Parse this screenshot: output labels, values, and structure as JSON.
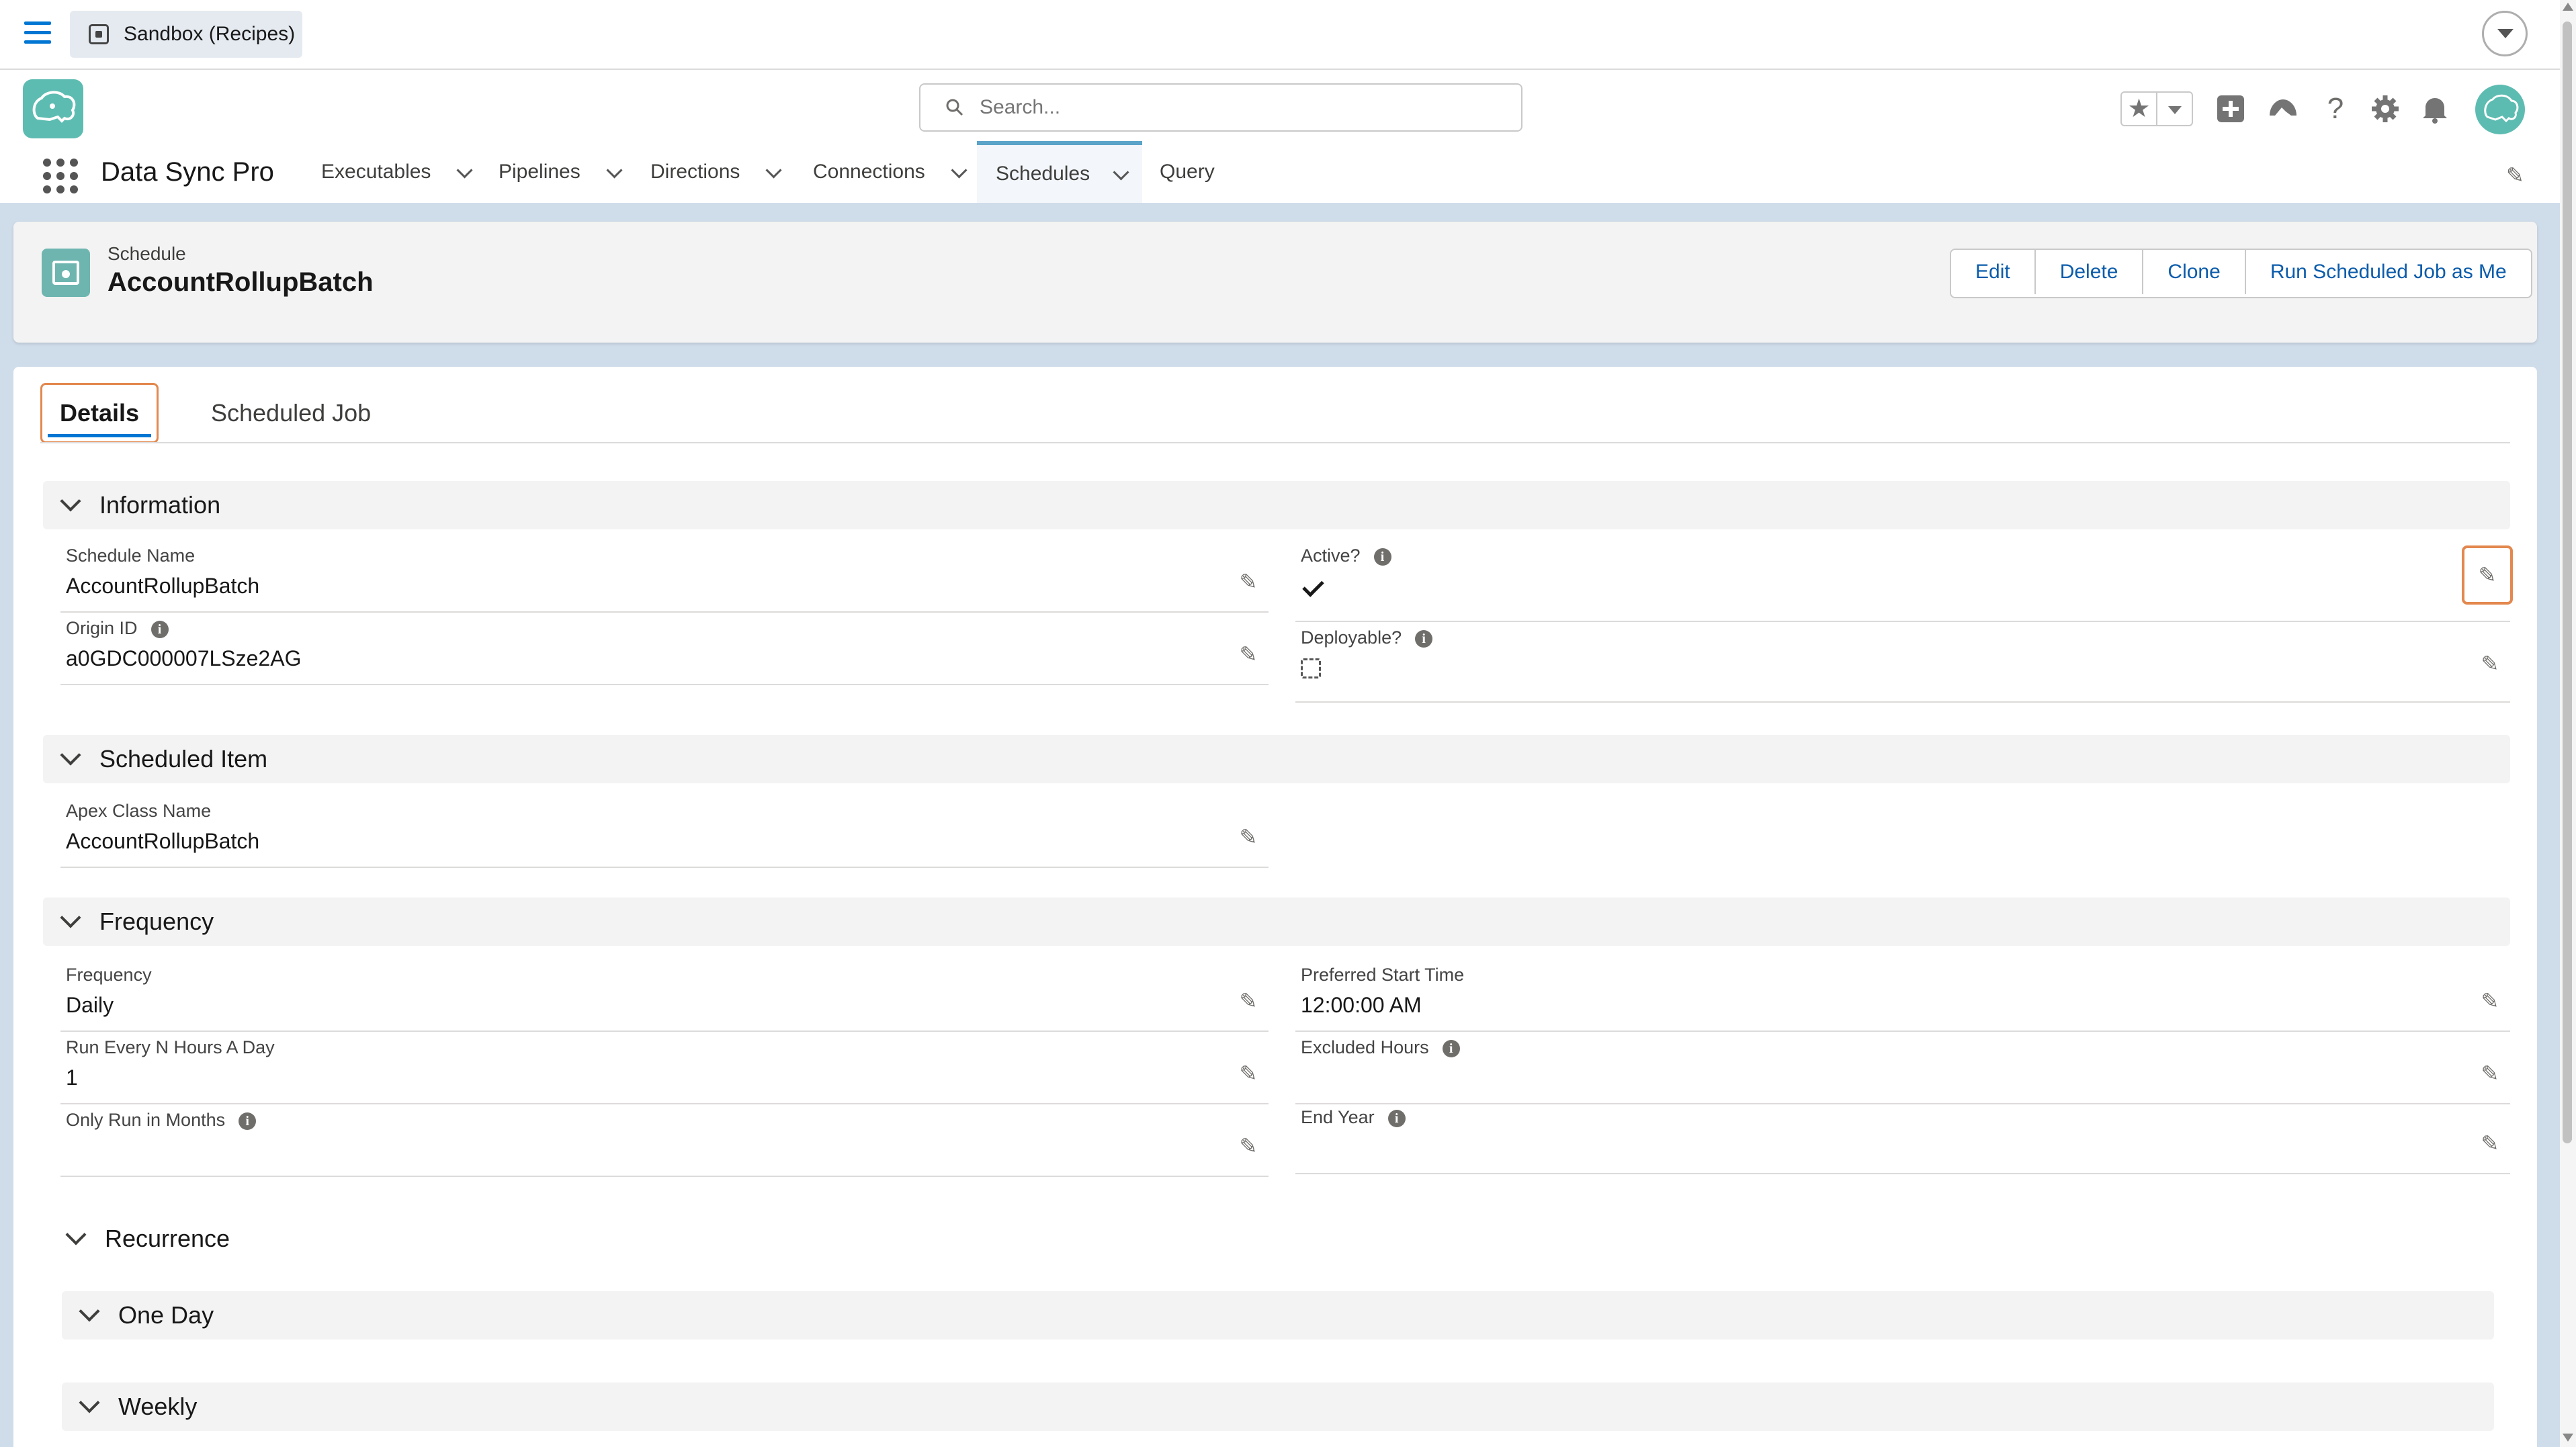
{
  "topbar": {
    "org_label": "Sandbox (Recipes)"
  },
  "search": {
    "placeholder": "Search..."
  },
  "nav": {
    "app_name": "Data Sync Pro",
    "items": [
      {
        "label": "Executables",
        "has_menu": true
      },
      {
        "label": "Pipelines",
        "has_menu": true
      },
      {
        "label": "Directions",
        "has_menu": true
      },
      {
        "label": "Connections",
        "has_menu": true
      },
      {
        "label": "Schedules",
        "has_menu": true,
        "active": true
      },
      {
        "label": "Query",
        "has_menu": false
      }
    ]
  },
  "record": {
    "type": "Schedule",
    "name": "AccountRollupBatch",
    "actions": [
      "Edit",
      "Delete",
      "Clone",
      "Run Scheduled Job as Me"
    ]
  },
  "tabs": {
    "active": "Details",
    "other": "Scheduled Job"
  },
  "sections": {
    "information": {
      "title": "Information",
      "schedule_name": {
        "label": "Schedule Name",
        "value": "AccountRollupBatch"
      },
      "origin_id": {
        "label": "Origin ID",
        "value": "a0GDC000007LSze2AG"
      },
      "active": {
        "label": "Active?",
        "checked": true
      },
      "deployable": {
        "label": "Deployable?",
        "checked": false
      }
    },
    "scheduled_item": {
      "title": "Scheduled Item",
      "apex_class_name": {
        "label": "Apex Class Name",
        "value": "AccountRollupBatch"
      }
    },
    "frequency": {
      "title": "Frequency",
      "frequency": {
        "label": "Frequency",
        "value": "Daily"
      },
      "run_every_n_hours": {
        "label": "Run Every N Hours A Day",
        "value": "1"
      },
      "only_run_in_months": {
        "label": "Only Run in Months",
        "value": ""
      },
      "preferred_start_time": {
        "label": "Preferred Start Time",
        "value": "12:00:00 AM"
      },
      "excluded_hours": {
        "label": "Excluded Hours",
        "value": ""
      },
      "end_year": {
        "label": "End Year",
        "value": ""
      }
    },
    "recurrence": {
      "title": "Recurrence"
    },
    "one_day": {
      "title": "One Day"
    },
    "weekly": {
      "title": "Weekly"
    }
  },
  "colors": {
    "accent": "#0176d3",
    "brand": "#5dbcb1",
    "highlight": "#e3884f",
    "page_bg": "#cfdcea"
  }
}
